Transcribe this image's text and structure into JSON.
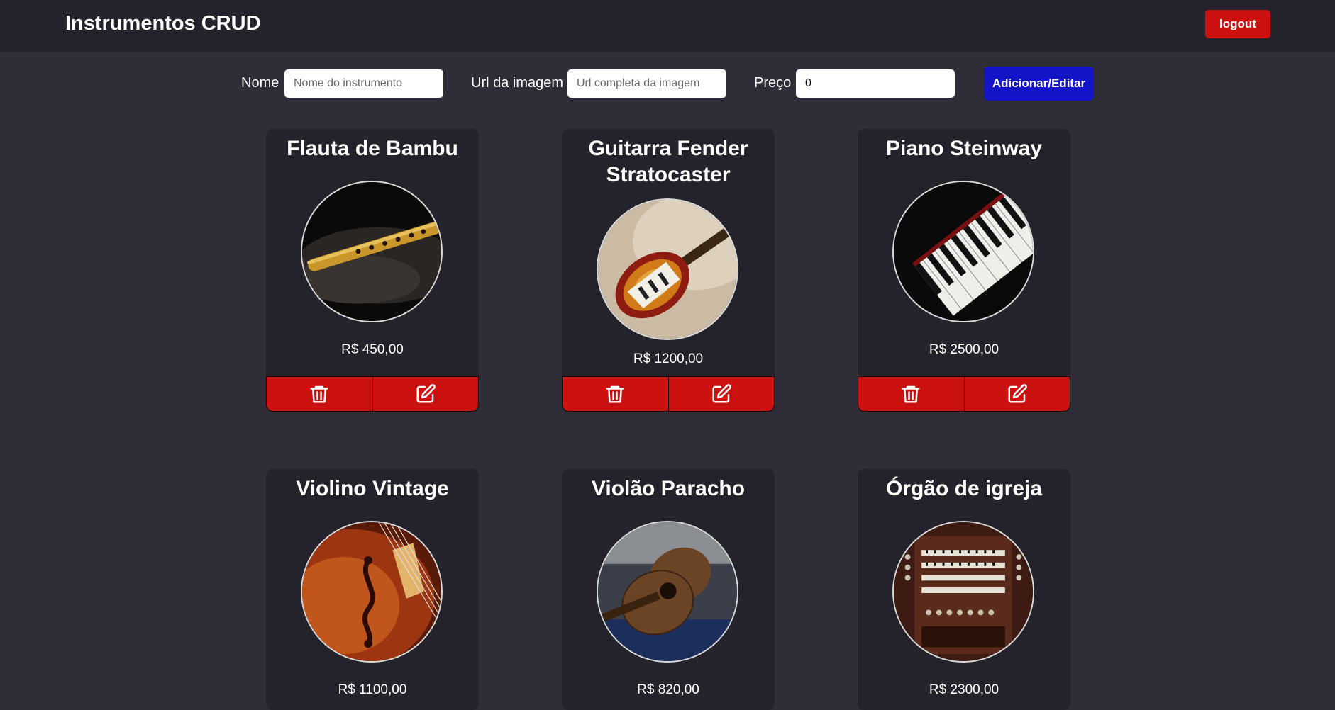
{
  "header": {
    "title": "Instrumentos CRUD",
    "logout_label": "logout",
    "accent": "#cc1111"
  },
  "form": {
    "name_label": "Nome",
    "name_placeholder": "Nome do instrumento",
    "name_value": "",
    "url_label": "Url da imagem",
    "url_placeholder": "Url completa da imagem",
    "url_value": "",
    "price_label": "Preço",
    "price_value": "0",
    "submit_label": "Adicionar/Editar",
    "submit_color": "#1414c8"
  },
  "instruments": [
    {
      "name": "Flauta de Bambu",
      "price": "R$ 450,00",
      "image": "bamboo-flute-photo"
    },
    {
      "name": "Guitarra Fender Stratocaster",
      "price": "R$ 1200,00",
      "image": "electric-guitar-photo"
    },
    {
      "name": "Piano Steinway",
      "price": "R$ 2500,00",
      "image": "piano-keys-photo"
    },
    {
      "name": "Violino Vintage",
      "price": "R$ 1100,00",
      "image": "violin-photo"
    },
    {
      "name": "Violão Paracho",
      "price": "R$ 820,00",
      "image": "acoustic-guitar-photo"
    },
    {
      "name": "Órgão de igreja",
      "price": "R$ 2300,00",
      "image": "church-organ-photo"
    }
  ],
  "icons": {
    "delete": "trash-icon",
    "edit": "edit-icon"
  }
}
